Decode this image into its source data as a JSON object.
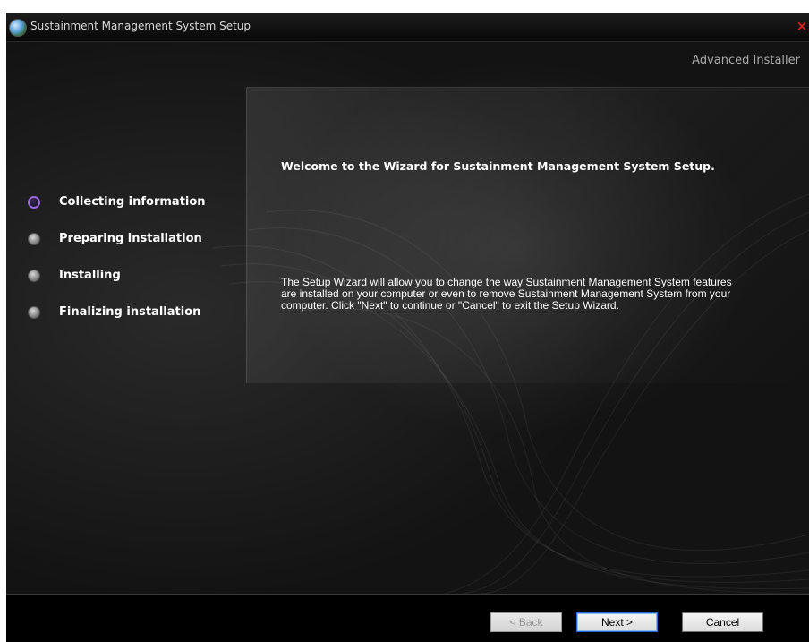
{
  "window": {
    "title": "Sustainment Management System Setup",
    "close_label": "×",
    "brand": "Advanced Installer"
  },
  "steps": [
    {
      "label": "Collecting information",
      "state": "active"
    },
    {
      "label": "Preparing installation",
      "state": "pending"
    },
    {
      "label": "Installing",
      "state": "pending"
    },
    {
      "label": "Finalizing installation",
      "state": "pending"
    }
  ],
  "main": {
    "welcome": "Welcome to the Wizard for Sustainment Management System Setup.",
    "description": "The Setup Wizard will allow you to change the way Sustainment Management System features are installed on your computer or even to remove Sustainment Management System from your computer.  Click \"Next\" to continue or \"Cancel\" to exit the Setup Wizard."
  },
  "buttons": {
    "back": "< Back",
    "next": "Next >",
    "cancel": "Cancel"
  },
  "colors": {
    "active_step": "#9a6ad8",
    "close": "#e02020",
    "background": "#151515"
  }
}
